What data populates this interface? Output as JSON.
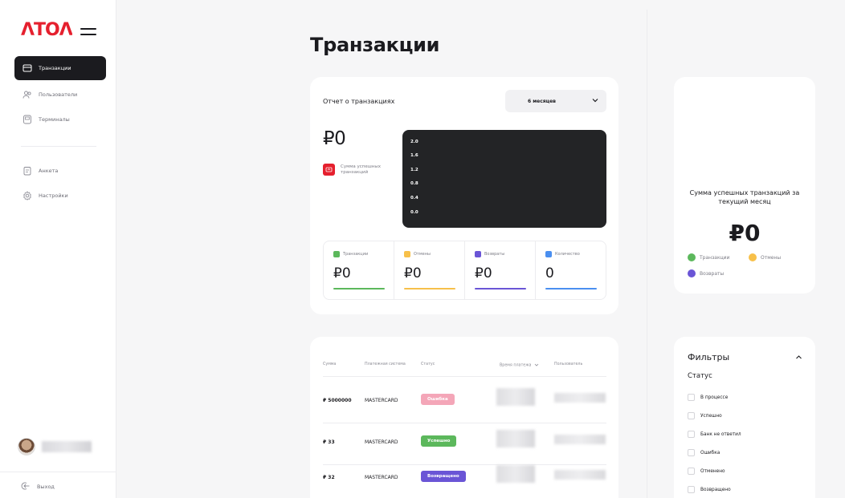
{
  "brand": {
    "logo": "ATOL",
    "accent": "#e5202e"
  },
  "sidebar": {
    "items": [
      {
        "label": "Транзакции",
        "icon": "card-icon",
        "active": true
      },
      {
        "label": "Пользователи",
        "icon": "users-icon",
        "active": false
      },
      {
        "label": "Терминалы",
        "icon": "terminal-icon",
        "active": false
      },
      {
        "label": "Анкета",
        "icon": "form-icon",
        "active": false
      },
      {
        "label": "Настройки",
        "icon": "gear-icon",
        "active": false
      }
    ],
    "logout": "Выход"
  },
  "page": {
    "title": "Транзакции"
  },
  "report": {
    "title": "Отчет о транзакциях",
    "period": "6 месяцев",
    "total": "₽0",
    "success_label": "Сумма успешных транзакций",
    "chart_ticks": [
      "2.0",
      "1.6",
      "1.2",
      "0.8",
      "0.4",
      "0.0"
    ],
    "stats": [
      {
        "label": "Транзакции",
        "value": "₽0",
        "color": "#5cb85c"
      },
      {
        "label": "Отмены",
        "value": "₽0",
        "color": "#f7c04a"
      },
      {
        "label": "Возвраты",
        "value": "₽0",
        "color": "#6a55d6"
      },
      {
        "label": "Количество",
        "value": "0",
        "color": "#4a8ff0"
      }
    ]
  },
  "table": {
    "columns": [
      "Сумма",
      "Платежная система",
      "Статус",
      "Время платежа",
      "Пользователь"
    ],
    "rows": [
      {
        "sum": "₽ 5000000",
        "payment_system": "MASTERCARD",
        "status": "Ошибка",
        "status_color": "#f4a6b8"
      },
      {
        "sum": "₽ 33",
        "payment_system": "MASTERCARD",
        "status": "Успешно",
        "status_color": "#5cb85c"
      },
      {
        "sum": "₽ 32",
        "payment_system": "MASTERCARD",
        "status": "Возвращено",
        "status_color": "#6a55d6"
      }
    ]
  },
  "month": {
    "title": "Сумма успешных транзакций за текущий месяц",
    "total": "₽0",
    "legend": [
      {
        "label": "Транзакции",
        "color": "#5cb85c"
      },
      {
        "label": "Отмены",
        "color": "#f7c04a"
      },
      {
        "label": "Возвраты",
        "color": "#6a55d6"
      }
    ]
  },
  "filters": {
    "title": "Фильтры",
    "status_label": "Статус",
    "options": [
      "В процессе",
      "Успешно",
      "Банк не ответил",
      "Ошибка",
      "Отменено",
      "Возвращено"
    ]
  }
}
